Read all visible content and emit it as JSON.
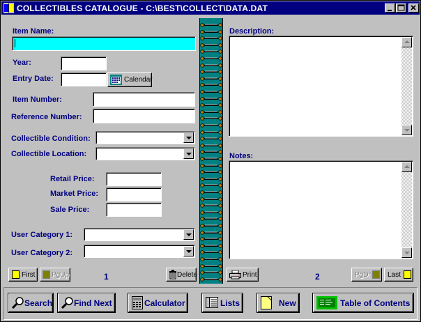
{
  "window": {
    "title": "COLLECTIBLES CATALOGUE - C:\\BEST\\COLLECT\\DATA.DAT"
  },
  "left_page": {
    "item_name_label": "Item Name:",
    "item_name_value": "",
    "year_label": "Year:",
    "year_value": "",
    "entry_date_label": "Entry Date:",
    "entry_date_value": "",
    "calendar_label": "Calendar",
    "item_number_label": "Item Number:",
    "reference_number_label": "Reference Number:",
    "condition_label": "Collectible Condition:",
    "location_label": "Collectible Location:",
    "retail_price_label": "Retail Price:",
    "market_price_label": "Market Price:",
    "sale_price_label": "Sale Price:",
    "user_cat1_label": "User Category 1:",
    "user_cat2_label": "User Category 2:",
    "first_label": "First",
    "pgup_label": "PgUp",
    "page_number": "1",
    "delete_label": "Delete"
  },
  "right_page": {
    "description_label": "Description:",
    "notes_label": "Notes:",
    "print_label": "Print",
    "page_number": "2",
    "pgdn_label": "PgDn",
    "last_label": "Last"
  },
  "toolbar": {
    "search": "Search",
    "find_next": "Find Next",
    "calculator": "Calculator",
    "lists": "Lists",
    "new": "New",
    "toc": "Table of Contents"
  }
}
